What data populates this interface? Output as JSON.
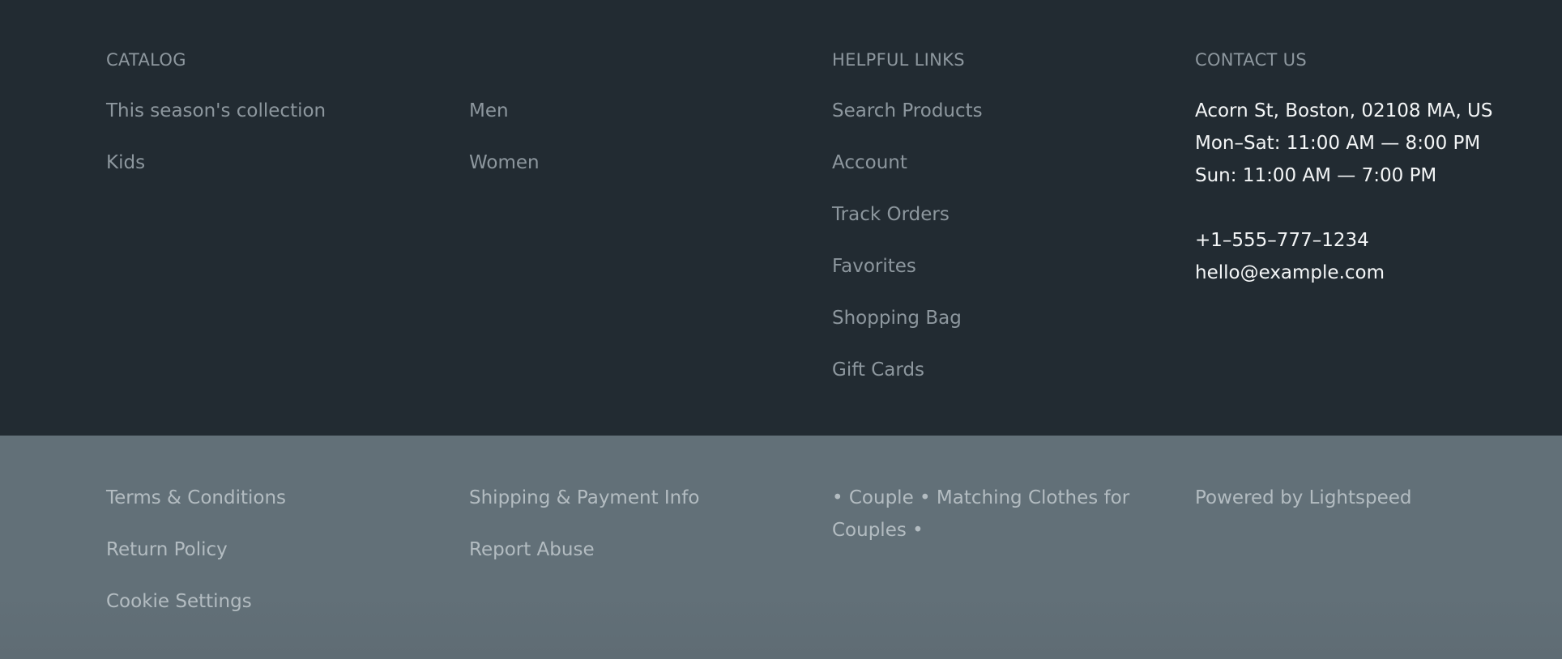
{
  "catalog": {
    "heading": "CATALOG",
    "col1": [
      "This season's collection",
      "Kids"
    ],
    "col2": [
      "Men",
      "Women"
    ]
  },
  "helpful": {
    "heading": "HELPFUL LINKS",
    "items": [
      "Search Products",
      "Account",
      "Track Orders",
      "Favorites",
      "Shopping Bag",
      "Gift Cards"
    ]
  },
  "contact": {
    "heading": "CONTACT US",
    "address": "Acorn St, Boston, 02108 MA, US",
    "hours_weekday": "Mon–Sat: 11:00 AM — 8:00 PM",
    "hours_sunday": "Sun: 11:00 AM — 7:00 PM",
    "phone": "+1–555–777–1234",
    "email": "hello@example.com"
  },
  "bottom": {
    "col1": [
      "Terms & Conditions",
      "Return Policy",
      "Cookie Settings"
    ],
    "col2": [
      "Shipping & Payment Info",
      "Report Abuse"
    ],
    "tagline": "• Couple • Matching Clothes for Couples •",
    "powered_by": "Powered by Lightspeed"
  },
  "colors": {
    "top_bg": "#222b32",
    "bottom_bg": "#627078",
    "link_text": "#8d979e",
    "contact_text": "#f4f6f7",
    "bottom_text": "#b3bcc1"
  }
}
